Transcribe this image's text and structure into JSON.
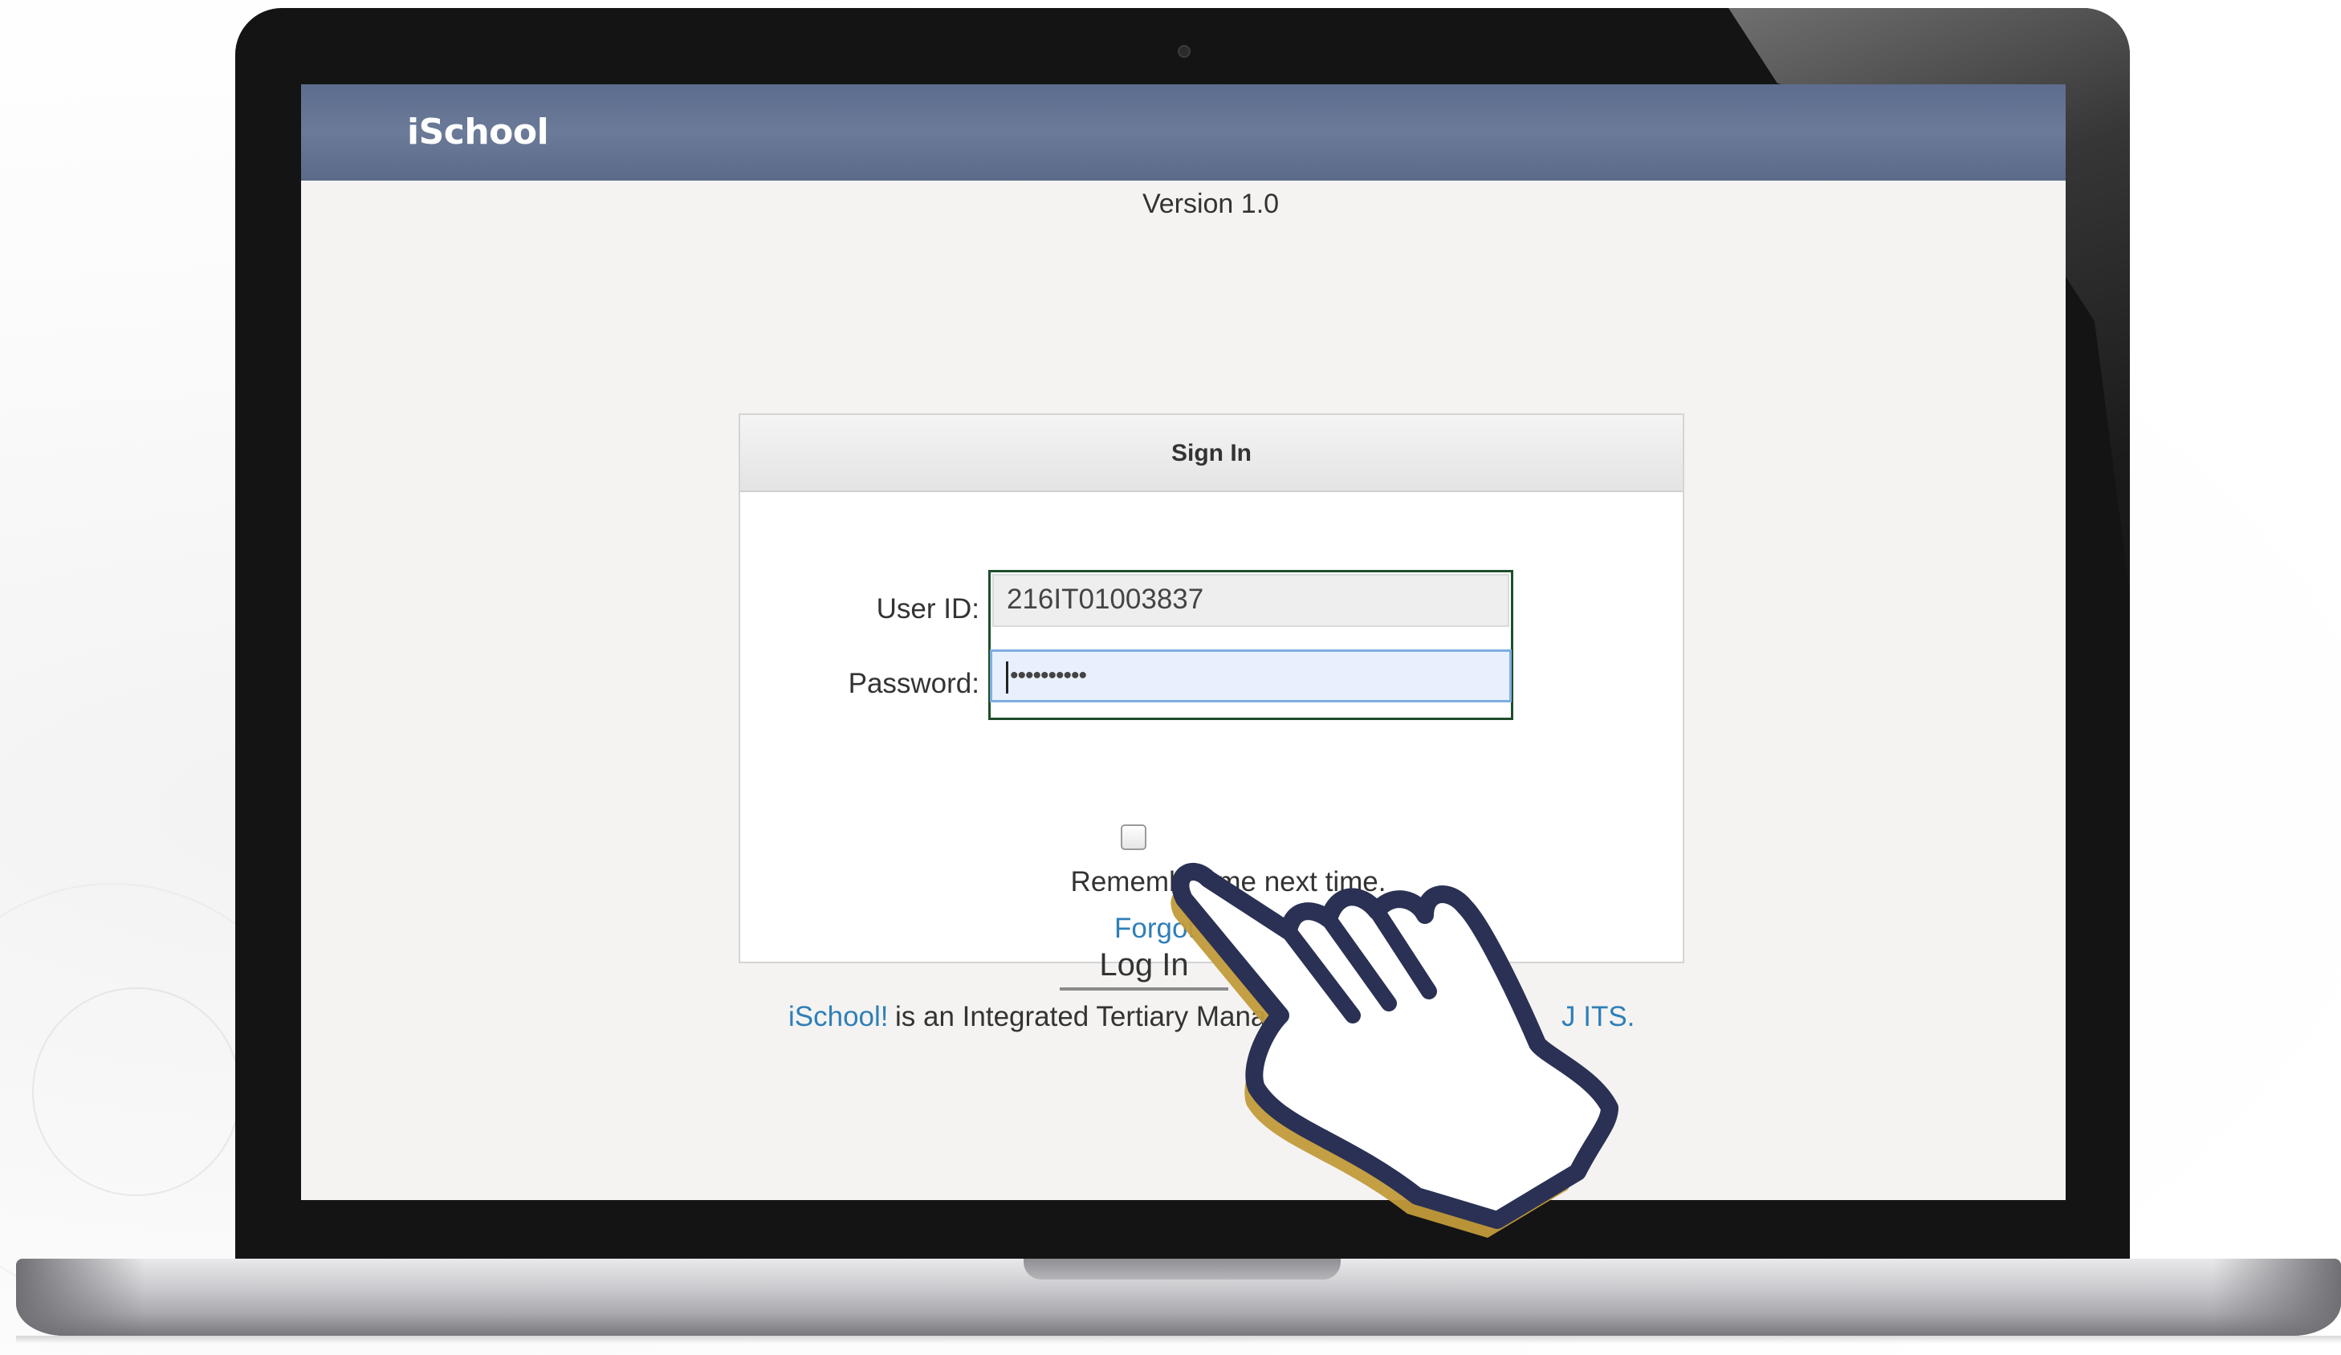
{
  "app": {
    "brand": "iSchool",
    "version": "Version 1.0"
  },
  "login": {
    "title": "Sign In",
    "user_label": "User ID:",
    "user_value": "216IT01003837",
    "password_label": "Password:",
    "password_value": "••••••••••",
    "remember_label": "Remember me next time.",
    "remember_checked": false,
    "forgot_label": "Forgot Password?",
    "login_button": "Log In"
  },
  "footer": {
    "lead": "iSchool!",
    "middle": "is an Integrated Tertiary Manag",
    "tail": "J ITS."
  },
  "colors": {
    "header": "#5d6d8e",
    "link": "#2f7fb8",
    "hand_outline": "#2b3154",
    "hand_shadow": "#c19a3a"
  },
  "icons": {
    "pointer": "pointing-hand-icon",
    "checkbox": "checkbox-icon"
  }
}
